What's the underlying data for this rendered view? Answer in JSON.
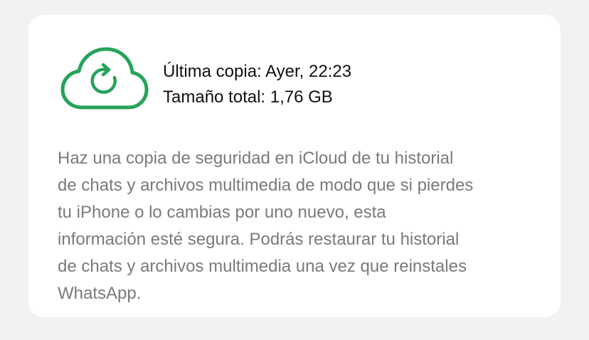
{
  "backup": {
    "last_backup": "Última copia: Ayer, 22:23",
    "total_size": "Tamaño total: 1,76 GB",
    "icon": "cloud-sync-icon",
    "accent_color": "#25a35a"
  },
  "description": {
    "lines": [
      "Haz una copia de seguridad en iCloud de tu historial",
      "de chats y archivos multimedia de modo que si pierdes",
      "tu iPhone o lo cambias por uno nuevo, esta",
      "información esté segura. Podrás restaurar tu historial",
      "de chats y archivos multimedia una vez que reinstales",
      "WhatsApp."
    ]
  }
}
